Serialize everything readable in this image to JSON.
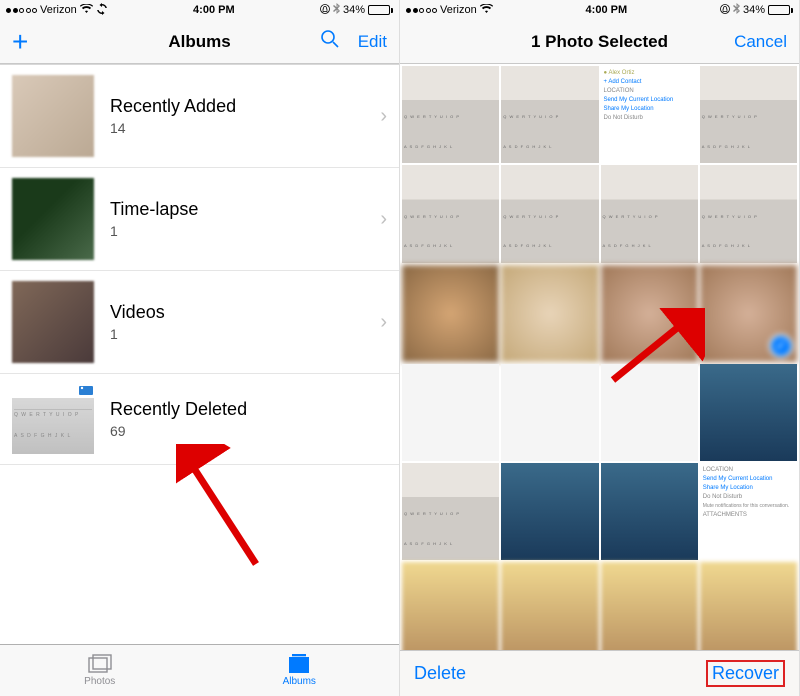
{
  "status": {
    "carrier": "Verizon",
    "time": "4:00 PM",
    "battery": "34%"
  },
  "left": {
    "nav": {
      "title": "Albums",
      "edit": "Edit"
    },
    "albums": [
      {
        "title": "Recently Added",
        "count": "14"
      },
      {
        "title": "Time-lapse",
        "count": "1"
      },
      {
        "title": "Videos",
        "count": "1"
      },
      {
        "title": "Recently Deleted",
        "count": "69"
      }
    ],
    "tabs": {
      "photos": "Photos",
      "albums": "Albums"
    }
  },
  "right": {
    "nav": {
      "title": "1 Photo Selected",
      "cancel": "Cancel"
    },
    "toolbar": {
      "delete": "Delete",
      "recover": "Recover"
    }
  }
}
